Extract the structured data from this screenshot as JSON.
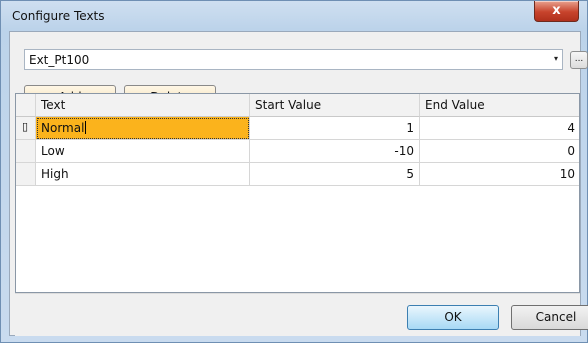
{
  "window": {
    "title": "Configure Texts",
    "close_label": "x"
  },
  "combo": {
    "value": "Ext_Pt100",
    "arrow_icon": "▾",
    "ellipsis_label": "..."
  },
  "toolbar": {
    "add_label": "Add",
    "delete_label": "Delete"
  },
  "table": {
    "columns": [
      "Text",
      "Start Value",
      "End Value"
    ],
    "row_marker": "▯",
    "rows": [
      {
        "text": "Normal",
        "start": "1",
        "end": "4"
      },
      {
        "text": "Low",
        "start": "-10",
        "end": "0"
      },
      {
        "text": "High",
        "start": "5",
        "end": "10"
      }
    ]
  },
  "footer": {
    "ok_label": "OK",
    "cancel_label": "Cancel"
  },
  "colors": {
    "active_cell": "#fbb31c",
    "close_button": "#c7432c"
  }
}
